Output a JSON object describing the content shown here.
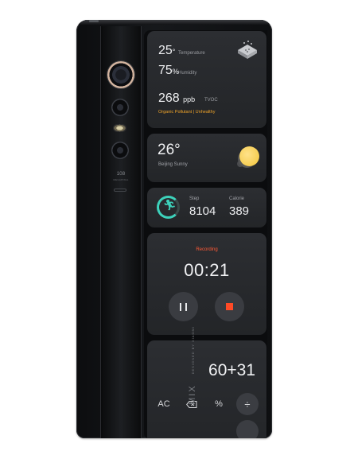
{
  "camera": {
    "mp_label": "108",
    "mp_sub": "MEGAPIXEL"
  },
  "branding": {
    "model": "MIX",
    "tagline": "DESIGNED BY XIAOMI"
  },
  "air_quality": {
    "temperature_value": "25",
    "temperature_unit": "°",
    "temperature_label": "Temperature",
    "humidity_value": "75",
    "humidity_unit": "%",
    "humidity_label": "Humidity",
    "tvoc_value": "268",
    "tvoc_unit": "ppb",
    "tvoc_label": "TVOC",
    "status_note": "Organic Pollutant | Unhealthy",
    "icon": "air-purifier-icon"
  },
  "weather": {
    "temperature": "26°",
    "location": "Beijing Sunny",
    "icon": "sun-icon"
  },
  "fitness": {
    "step_label": "Step",
    "step_value": "8104",
    "calorie_label": "Calorie",
    "calorie_value": "389",
    "icon": "runner-icon",
    "accent": "#3dd2bb"
  },
  "recorder": {
    "status": "Recording",
    "time": "00:21",
    "accent": "#ff5a36"
  },
  "calculator": {
    "display": "60+31",
    "keys": {
      "clear": "AC",
      "percent": "%",
      "divide": "÷"
    }
  }
}
